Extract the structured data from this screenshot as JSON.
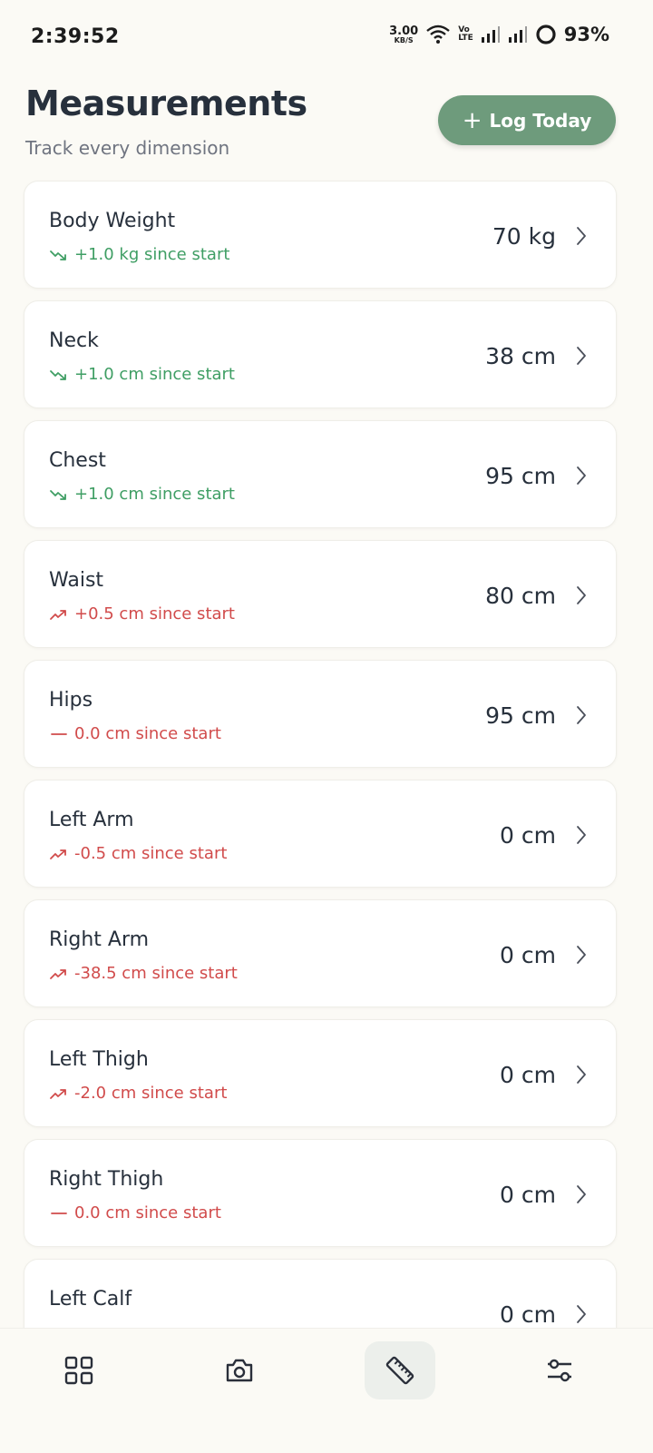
{
  "status": {
    "time": "2:39:52",
    "net_speed": "3.00",
    "net_unit": "KB/S",
    "volte_top": "Vo",
    "volte_bottom": "LTE",
    "battery": "93%"
  },
  "header": {
    "title": "Measurements",
    "subtitle": "Track every dimension",
    "log_button_label": "Log Today"
  },
  "measurements": [
    {
      "name": "Body Weight",
      "value": "70 kg",
      "delta": "+1.0 kg since start",
      "trend": "down",
      "status": "good"
    },
    {
      "name": "Neck",
      "value": "38 cm",
      "delta": "+1.0 cm since start",
      "trend": "down",
      "status": "good"
    },
    {
      "name": "Chest",
      "value": "95 cm",
      "delta": "+1.0 cm since start",
      "trend": "down",
      "status": "good"
    },
    {
      "name": "Waist",
      "value": "80 cm",
      "delta": "+0.5 cm since start",
      "trend": "up",
      "status": "bad"
    },
    {
      "name": "Hips",
      "value": "95 cm",
      "delta": "0.0 cm since start",
      "trend": "flat",
      "status": "bad"
    },
    {
      "name": "Left Arm",
      "value": "0 cm",
      "delta": "-0.5 cm since start",
      "trend": "up",
      "status": "bad"
    },
    {
      "name": "Right Arm",
      "value": "0 cm",
      "delta": "-38.5 cm since start",
      "trend": "up",
      "status": "bad"
    },
    {
      "name": "Left Thigh",
      "value": "0 cm",
      "delta": "-2.0 cm since start",
      "trend": "up",
      "status": "bad"
    },
    {
      "name": "Right Thigh",
      "value": "0 cm",
      "delta": "0.0 cm since start",
      "trend": "flat",
      "status": "bad"
    },
    {
      "name": "Left Calf",
      "value": "0 cm",
      "delta": "",
      "trend": "none",
      "status": "bad"
    }
  ],
  "nav": [
    {
      "icon": "dashboard-icon",
      "active": false
    },
    {
      "icon": "camera-icon",
      "active": false
    },
    {
      "icon": "ruler-icon",
      "active": true
    },
    {
      "icon": "settings-sliders-icon",
      "active": false
    }
  ],
  "colors": {
    "accent": "#6E9B7C",
    "good": "#3F9E64",
    "bad": "#D14B4B",
    "background": "#FBFAF5",
    "card": "#FFFFFF",
    "text": "#27303C"
  }
}
